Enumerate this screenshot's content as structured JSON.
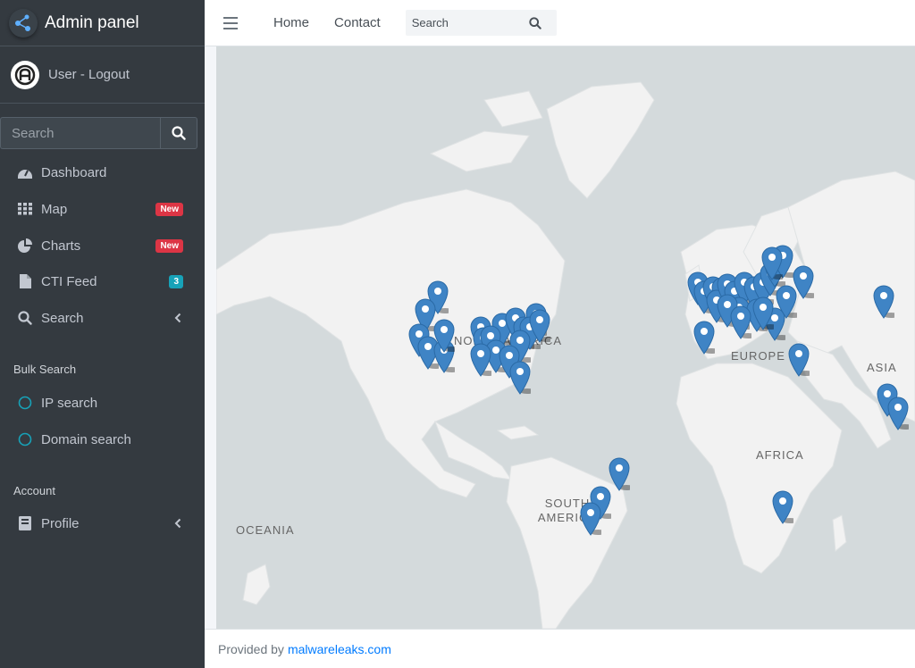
{
  "brand": {
    "title": "Admin panel"
  },
  "user": {
    "label": "User - Logout"
  },
  "sidebar": {
    "search_placeholder": "Search",
    "items": [
      {
        "label": "Dashboard",
        "icon": "dashboard-icon"
      },
      {
        "label": "Map",
        "icon": "grid-icon",
        "badge": "New"
      },
      {
        "label": "Charts",
        "icon": "pie-chart-icon",
        "badge": "New"
      },
      {
        "label": "CTI Feed",
        "icon": "file-icon",
        "badge": "3"
      },
      {
        "label": "Search",
        "icon": "search-icon"
      }
    ],
    "bulk_header": "Bulk Search",
    "bulk_items": [
      {
        "label": "IP search"
      },
      {
        "label": "Domain search"
      }
    ],
    "account_header": "Account",
    "account_items": [
      {
        "label": "Profile",
        "icon": "book-icon"
      }
    ]
  },
  "topbar": {
    "links": [
      "Home",
      "Contact"
    ],
    "search_placeholder": "Search"
  },
  "map": {
    "labels": {
      "north_america": "NORTH AMERICA",
      "europe": "EUROPE",
      "asia": "ASIA",
      "africa": "AFRICA",
      "south_america": "SOUTH AMERICA",
      "oceania": "OCEANIA"
    },
    "marker_color": "#3f84c5"
  },
  "footer": {
    "prefix": "Provided by",
    "link": "malwareleaks.com"
  },
  "colors": {
    "sidebar": "#343a40",
    "badge_new": "#dc3545",
    "badge_count": "#17a2b8",
    "land": "#f2f2f2",
    "water": "#d4dadc"
  }
}
